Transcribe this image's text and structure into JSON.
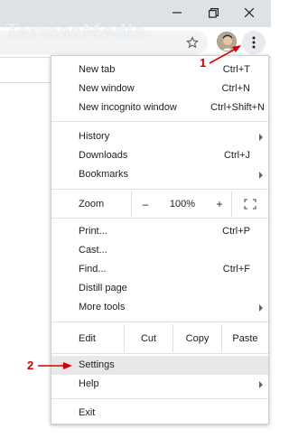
{
  "watermark": "TermasMedia",
  "annotations": {
    "step1": "1",
    "step2": "2"
  },
  "icons": {
    "minimize": "minimize-icon",
    "maximize": "restore-icon",
    "close": "close-icon",
    "bookmark": "star-icon",
    "profile": "avatar",
    "menu": "three-dot-menu-icon",
    "submenu": "chevron-right-icon",
    "fullscreen": "fullscreen-icon"
  },
  "colors": {
    "annotation": "#d40000",
    "highlight": "#e8e8e8",
    "titlebar": "#dee1e6"
  },
  "menu": {
    "group1": [
      {
        "label": "New tab",
        "shortcut": "Ctrl+T"
      },
      {
        "label": "New window",
        "shortcut": "Ctrl+N"
      },
      {
        "label": "New incognito window",
        "shortcut": "Ctrl+Shift+N"
      }
    ],
    "group2": [
      {
        "label": "History",
        "shortcut": ""
      },
      {
        "label": "Downloads",
        "shortcut": "Ctrl+J"
      },
      {
        "label": "Bookmarks",
        "shortcut": ""
      }
    ],
    "zoom": {
      "label": "Zoom",
      "minus": "–",
      "value": "100%",
      "plus": "+"
    },
    "group3": [
      {
        "label": "Print...",
        "shortcut": "Ctrl+P"
      },
      {
        "label": "Cast...",
        "shortcut": ""
      },
      {
        "label": "Find...",
        "shortcut": "Ctrl+F"
      },
      {
        "label": "Distill page",
        "shortcut": ""
      },
      {
        "label": "More tools",
        "shortcut": ""
      }
    ],
    "edit": {
      "label": "Edit",
      "cut": "Cut",
      "copy": "Copy",
      "paste": "Paste"
    },
    "group4": [
      {
        "label": "Settings",
        "shortcut": ""
      },
      {
        "label": "Help",
        "shortcut": ""
      }
    ],
    "group5": [
      {
        "label": "Exit",
        "shortcut": ""
      }
    ]
  }
}
